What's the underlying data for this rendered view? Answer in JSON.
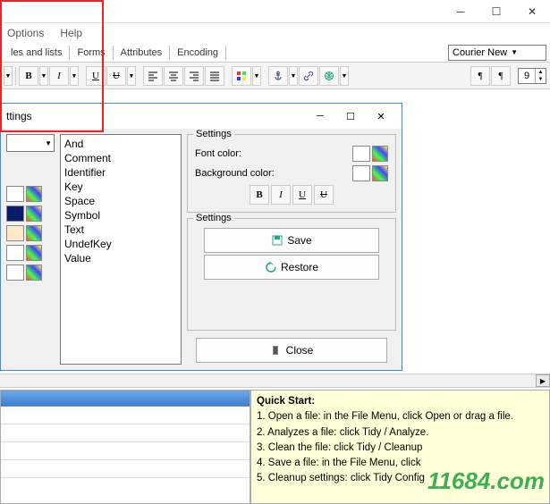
{
  "menu": {
    "options": "Options",
    "help": "Help"
  },
  "tabs": {
    "t1": "les and lists",
    "t2": "Forms",
    "t3": "Attributes",
    "t4": "Encoding"
  },
  "font_select": {
    "value": "Courier New",
    "size": "9"
  },
  "toolbar": {
    "bold": "B",
    "italic": "I",
    "underline": "U",
    "strike_u": "U"
  },
  "dialog": {
    "title": "ttings",
    "list": [
      "And",
      "Comment",
      "Identifier",
      "Key",
      "Space",
      "Symbol",
      "Text",
      "UndefKey",
      "Value"
    ],
    "settings_legend": "Settings",
    "font_color_label": "Font color:",
    "bg_color_label": "Background color:",
    "save": "Save",
    "restore": "Restore",
    "close": "Close"
  },
  "quickstart": {
    "title": "Quick Start:",
    "l1": "1. Open a file: in the File Menu, click Open or drag a file.",
    "l2": "2. Analyzes a file: click Tidy / Analyze.",
    "l3": "3. Clean the file: click Tidy / Cleanup",
    "l4": "4. Save a file: in the File Menu, click ",
    "l5": "5. Cleanup settings: click Tidy Config"
  },
  "watermark": "11684.com"
}
